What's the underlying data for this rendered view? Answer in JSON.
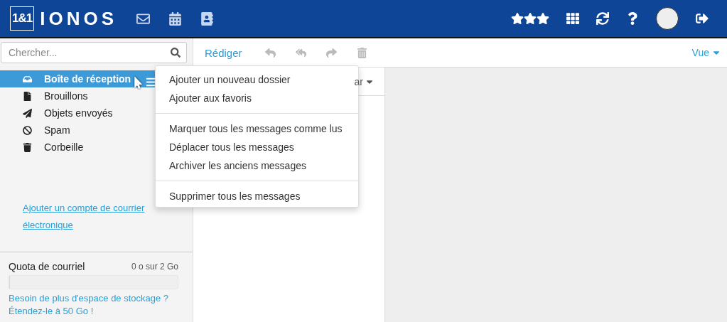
{
  "header": {
    "logo_box": "1&1",
    "logo_word": "IONOS",
    "apps": [
      {
        "kind": "mail"
      },
      {
        "kind": "calendar"
      },
      {
        "kind": "contacts"
      }
    ],
    "tools": [
      {
        "kind": "stars"
      },
      {
        "kind": "grid"
      },
      {
        "kind": "refresh"
      },
      {
        "kind": "help"
      },
      {
        "kind": "avatar"
      },
      {
        "kind": "logout"
      }
    ]
  },
  "search": {
    "placeholder": "Chercher..."
  },
  "folders": [
    {
      "label": "Boîte de réception",
      "kind": "inbox",
      "selected": true
    },
    {
      "label": "Brouillons",
      "kind": "drafts",
      "selected": false
    },
    {
      "label": "Objets envoyés",
      "kind": "sent",
      "selected": false
    },
    {
      "label": "Spam",
      "kind": "spam",
      "selected": false
    },
    {
      "label": "Corbeille",
      "kind": "trash",
      "selected": false
    }
  ],
  "add_account_link": "Ajouter un compte de courrier électronique",
  "quota": {
    "label": "Quota de courriel",
    "reading": "0 o sur 2 Go",
    "level": 0,
    "upgrade_link": "Besoin de plus d'espace de stockage ? Étendez-le à 50 Go !"
  },
  "toolbar": {
    "compose": "Rédiger",
    "actions": [
      {
        "kind": "reply",
        "disabled": true
      },
      {
        "kind": "reply_all",
        "disabled": true
      },
      {
        "kind": "forward",
        "disabled": true
      },
      {
        "kind": "delete",
        "disabled": true
      }
    ],
    "view": "Vue"
  },
  "list_header": {
    "sort_label": "ar"
  },
  "folder_menu": {
    "groups": [
      [
        "Ajouter un nouveau dossier",
        "Ajouter aux favoris"
      ],
      [
        "Marquer tous les messages comme lus",
        "Déplacer tous les messages",
        "Archiver les anciens messages"
      ],
      [
        "Supprimer tous les messages"
      ]
    ]
  }
}
